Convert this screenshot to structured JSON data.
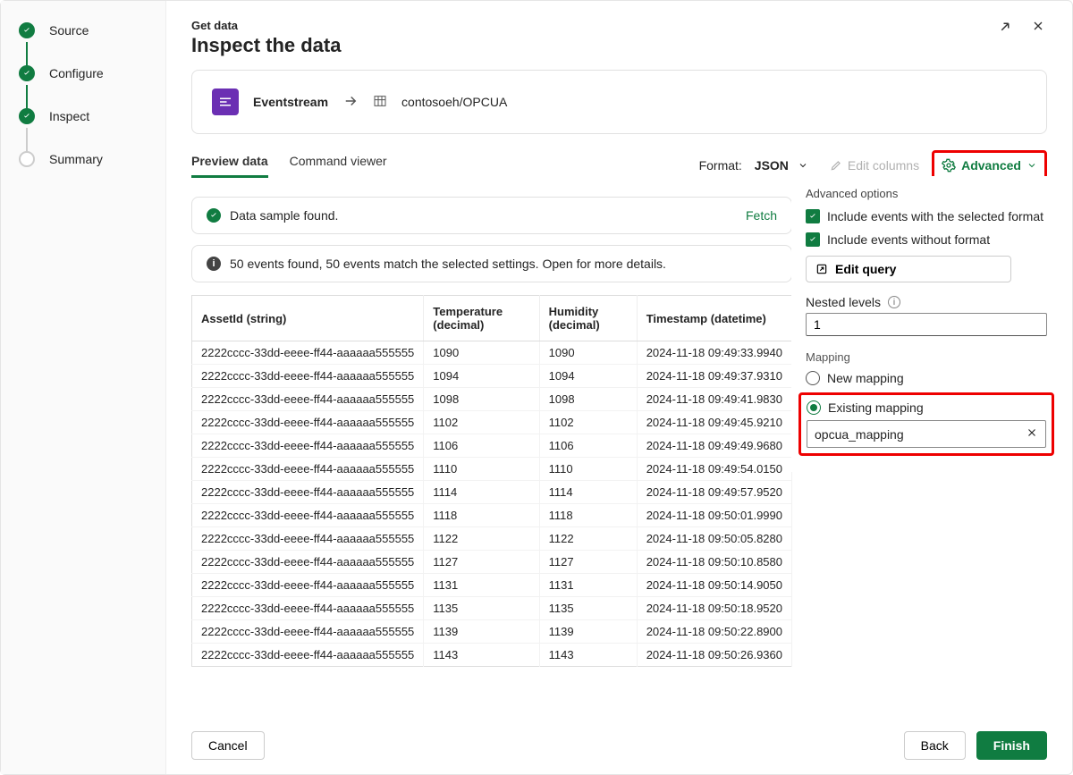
{
  "steps": [
    {
      "label": "Source",
      "state": "done"
    },
    {
      "label": "Configure",
      "state": "done"
    },
    {
      "label": "Inspect",
      "state": "done-current"
    },
    {
      "label": "Summary",
      "state": "pending"
    }
  ],
  "header": {
    "breadcrumb": "Get data",
    "title": "Inspect the data"
  },
  "source": {
    "type_label": "Eventstream",
    "destination": "contosoeh/OPCUA"
  },
  "tabs": {
    "preview": "Preview data",
    "command": "Command viewer",
    "active": "preview"
  },
  "controls": {
    "format_label": "Format:",
    "format_value": "JSON",
    "edit_columns": "Edit columns",
    "advanced": "Advanced"
  },
  "notices": {
    "sample_found": "Data sample found.",
    "fetch_again": "Fetch",
    "events_summary": "50 events found, 50 events match the selected settings. Open for more details."
  },
  "advanced_panel": {
    "title": "Advanced options",
    "include_selected_format": "Include events with the selected format",
    "include_without_format": "Include events without format",
    "edit_query": "Edit query",
    "nested_levels_label": "Nested levels",
    "nested_levels_value": "1",
    "mapping_label": "Mapping",
    "mapping_new": "New mapping",
    "mapping_existing": "Existing mapping",
    "mapping_selected": "existing",
    "mapping_value": "opcua_mapping"
  },
  "table": {
    "columns": [
      "AssetId (string)",
      "Temperature (decimal)",
      "Humidity (decimal)",
      "Timestamp (datetime)"
    ],
    "rows": [
      [
        "2222cccc-33dd-eeee-ff44-aaaaaa555555",
        "1090",
        "1090",
        "2024-11-18 09:49:33.9940"
      ],
      [
        "2222cccc-33dd-eeee-ff44-aaaaaa555555",
        "1094",
        "1094",
        "2024-11-18 09:49:37.9310"
      ],
      [
        "2222cccc-33dd-eeee-ff44-aaaaaa555555",
        "1098",
        "1098",
        "2024-11-18 09:49:41.9830"
      ],
      [
        "2222cccc-33dd-eeee-ff44-aaaaaa555555",
        "1102",
        "1102",
        "2024-11-18 09:49:45.9210"
      ],
      [
        "2222cccc-33dd-eeee-ff44-aaaaaa555555",
        "1106",
        "1106",
        "2024-11-18 09:49:49.9680"
      ],
      [
        "2222cccc-33dd-eeee-ff44-aaaaaa555555",
        "1110",
        "1110",
        "2024-11-18 09:49:54.0150"
      ],
      [
        "2222cccc-33dd-eeee-ff44-aaaaaa555555",
        "1114",
        "1114",
        "2024-11-18 09:49:57.9520"
      ],
      [
        "2222cccc-33dd-eeee-ff44-aaaaaa555555",
        "1118",
        "1118",
        "2024-11-18 09:50:01.9990"
      ],
      [
        "2222cccc-33dd-eeee-ff44-aaaaaa555555",
        "1122",
        "1122",
        "2024-11-18 09:50:05.8280"
      ],
      [
        "2222cccc-33dd-eeee-ff44-aaaaaa555555",
        "1127",
        "1127",
        "2024-11-18 09:50:10.8580"
      ],
      [
        "2222cccc-33dd-eeee-ff44-aaaaaa555555",
        "1131",
        "1131",
        "2024-11-18 09:50:14.9050"
      ],
      [
        "2222cccc-33dd-eeee-ff44-aaaaaa555555",
        "1135",
        "1135",
        "2024-11-18 09:50:18.9520"
      ],
      [
        "2222cccc-33dd-eeee-ff44-aaaaaa555555",
        "1139",
        "1139",
        "2024-11-18 09:50:22.8900"
      ],
      [
        "2222cccc-33dd-eeee-ff44-aaaaaa555555",
        "1143",
        "1143",
        "2024-11-18 09:50:26.9360"
      ]
    ]
  },
  "footer": {
    "cancel": "Cancel",
    "back": "Back",
    "finish": "Finish"
  }
}
